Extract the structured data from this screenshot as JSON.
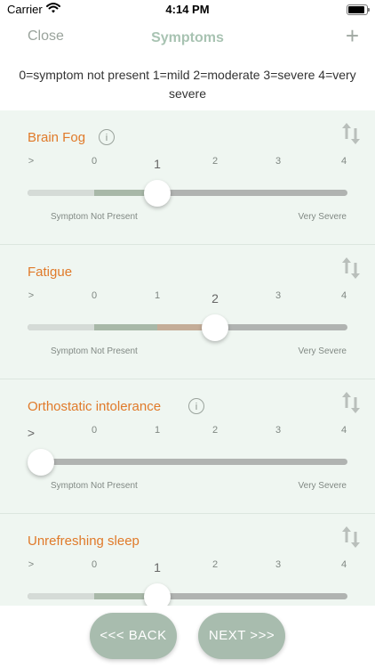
{
  "status": {
    "carrier": "Carrier",
    "time": "4:14 PM"
  },
  "nav": {
    "close_label": "Close",
    "title": "Symptoms",
    "add_label": "+"
  },
  "legend": "0=symptom not present 1=mild 2=moderate 3=severe 4=very severe",
  "scale": {
    "ticks": [
      ">",
      "0",
      "1",
      "2",
      "3",
      "4"
    ],
    "min_label": "Symptom Not Present",
    "max_label": "Very Severe"
  },
  "colors": {
    "title": "#e07a2a",
    "track": "#b0b3b1",
    "segment_na": "#d5dbd7",
    "segment_mild": "#a8b8a8",
    "segment_moderate": "#c4ad98",
    "card_bg": "#eff6f1"
  },
  "symptoms": [
    {
      "name": "Brain Fog",
      "has_info": true,
      "value": 1
    },
    {
      "name": "Fatigue",
      "has_info": false,
      "value": 2
    },
    {
      "name": "Orthostatic intolerance",
      "has_info": true,
      "value": ">"
    },
    {
      "name": "Unrefreshing sleep",
      "has_info": false,
      "value": 1
    }
  ],
  "footer": {
    "back_label": "<<< BACK",
    "next_label": "NEXT >>>"
  }
}
